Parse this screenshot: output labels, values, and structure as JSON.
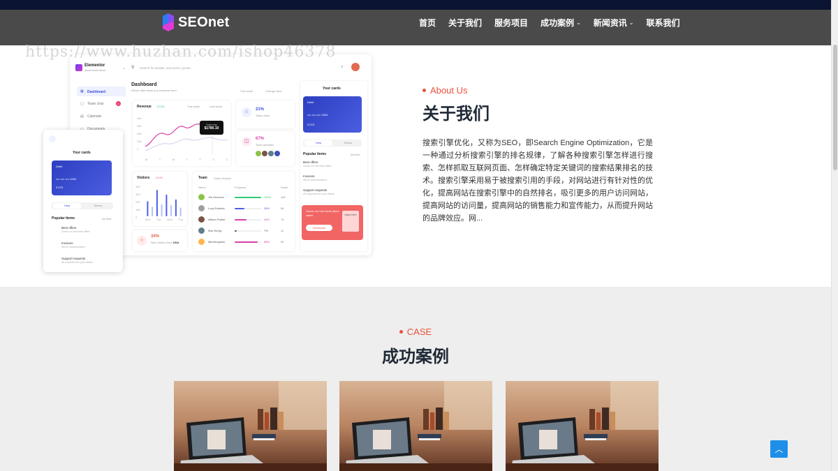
{
  "brand": {
    "name": "SEOnet"
  },
  "nav": [
    {
      "label": "首页",
      "dropdown": false
    },
    {
      "label": "关于我们",
      "dropdown": false
    },
    {
      "label": "服务项目",
      "dropdown": false
    },
    {
      "label": "成功案例",
      "dropdown": true
    },
    {
      "label": "新闻资讯",
      "dropdown": true
    },
    {
      "label": "联系我们",
      "dropdown": false
    }
  ],
  "watermark": "https://www.huzhan.com/ishop46378",
  "about": {
    "eyebrow": "About Us",
    "title": "关于我们",
    "body": "搜索引擎优化，又称为SEO，即Search Engine Optimization，它是一种通过分析搜索引擎的排名规律，了解各种搜索引擎怎样进行搜索、怎样抓取互联网页面、怎样确定特定关键词的搜索结果排名的技术。搜索引擎采用易于被搜索引用的手段，对网站进行有针对性的优化，提高网站在搜索引擎中的自然排名，吸引更多的用户访问网站，提高网站的访问量，提高网站的销售能力和宣传能力，从而提升网站的品牌效应。网..."
  },
  "mockup": {
    "app_name": "Elementor",
    "app_sub": "@elementordocs",
    "search_placeholder": "Search for people, document, goods...",
    "menu": [
      "Dashboard",
      "Team chat",
      "Calendar",
      "Documents"
    ],
    "team_chat_badge": "3",
    "dashboard_title": "Dashboard",
    "dashboard_sub": "Whole data about you business here",
    "this_week": "This week",
    "change_view": "Change view",
    "revenue_label": "Revenue",
    "revenue_change": "+0.3%",
    "legend_this": "This week",
    "legend_last": "Last week",
    "tooltip_day": "Saturday",
    "tooltip_value": "$1780.10",
    "revenue_y": [
      "40k",
      "30k",
      "20k",
      "10k",
      "0"
    ],
    "revenue_x": [
      "M",
      "T",
      "W",
      "T",
      "F",
      "S",
      "S"
    ],
    "stat1_value": "21%",
    "stat1_label": "Tasks done",
    "stat2_value": "67%",
    "stat2_label": "Team activities",
    "visitors_label": "Visitors",
    "visitors_change": "-0.1%",
    "visitors_y": [
      "400",
      "300",
      "200",
      "100",
      "0"
    ],
    "visitors_x": [
      "Mon",
      "Tue",
      "Wed",
      "Thu"
    ],
    "visitors_values": [
      190,
      120,
      330,
      150,
      270,
      140,
      210,
      110
    ],
    "usa_value": "34%",
    "usa_label": "New visitors from",
    "usa_country": "USA",
    "team_label": "Team",
    "team_filter": "Sales Division",
    "team_cols": [
      "Name",
      "Progress",
      "Deals"
    ],
    "team_rows": [
      {
        "name": "Jim Morrison",
        "pct": "100%",
        "deals": "102",
        "fill": 1.0,
        "color": "#2ecc71"
      },
      {
        "name": "Lucy Roberts",
        "pct": "38%",
        "deals": "54",
        "fill": 0.38,
        "color": "#4c5de8"
      },
      {
        "name": "Allison Parker",
        "pct": "44%",
        "deals": "74",
        "fill": 0.44,
        "color": "#d63fa8"
      },
      {
        "name": "Max Wong",
        "pct": "7%",
        "deals": "11",
        "fill": 0.07,
        "color": "#555555"
      },
      {
        "name": "Mia Benjamin",
        "pct": "88%",
        "deals": "92",
        "fill": 0.88,
        "color": "#d63fa8"
      }
    ],
    "your_cards": "Your cards",
    "card_type": "Debit",
    "card_number": "•••• •••• •••• 1954",
    "card_expiry": "07/23",
    "tab_help": "Help",
    "tab_teams": "Teams",
    "popular_label": "Popular items",
    "popular_feed": "All feed",
    "popular_items": [
      {
        "title": "Best offers",
        "sub": "Check our new best offers"
      },
      {
        "title": "Invoices",
        "sub": "Whole documentation"
      },
      {
        "title": "Support requests",
        "sub": "All requests from your clients"
      }
    ],
    "promo_text": "Check our new book about sales!",
    "promo_book": "Sales Here",
    "promo_button": "Download"
  },
  "case": {
    "eyebrow": "CASE",
    "title": "成功案例",
    "cards": [
      {
        "alt": "laptop-desk-photo"
      },
      {
        "alt": "laptop-desk-photo"
      },
      {
        "alt": "laptop-desk-photo"
      }
    ]
  },
  "colors": {
    "accent": "#e8523b",
    "header_bg": "#4a4a4a",
    "top_strip": "#0b1433",
    "title_text": "#1f2a36",
    "to_top": "#1e8fe8",
    "case_bg": "#eeeeee"
  },
  "icons": {
    "to_top": "chevron-up-icon",
    "dropdown": "chevron-down-icon"
  }
}
